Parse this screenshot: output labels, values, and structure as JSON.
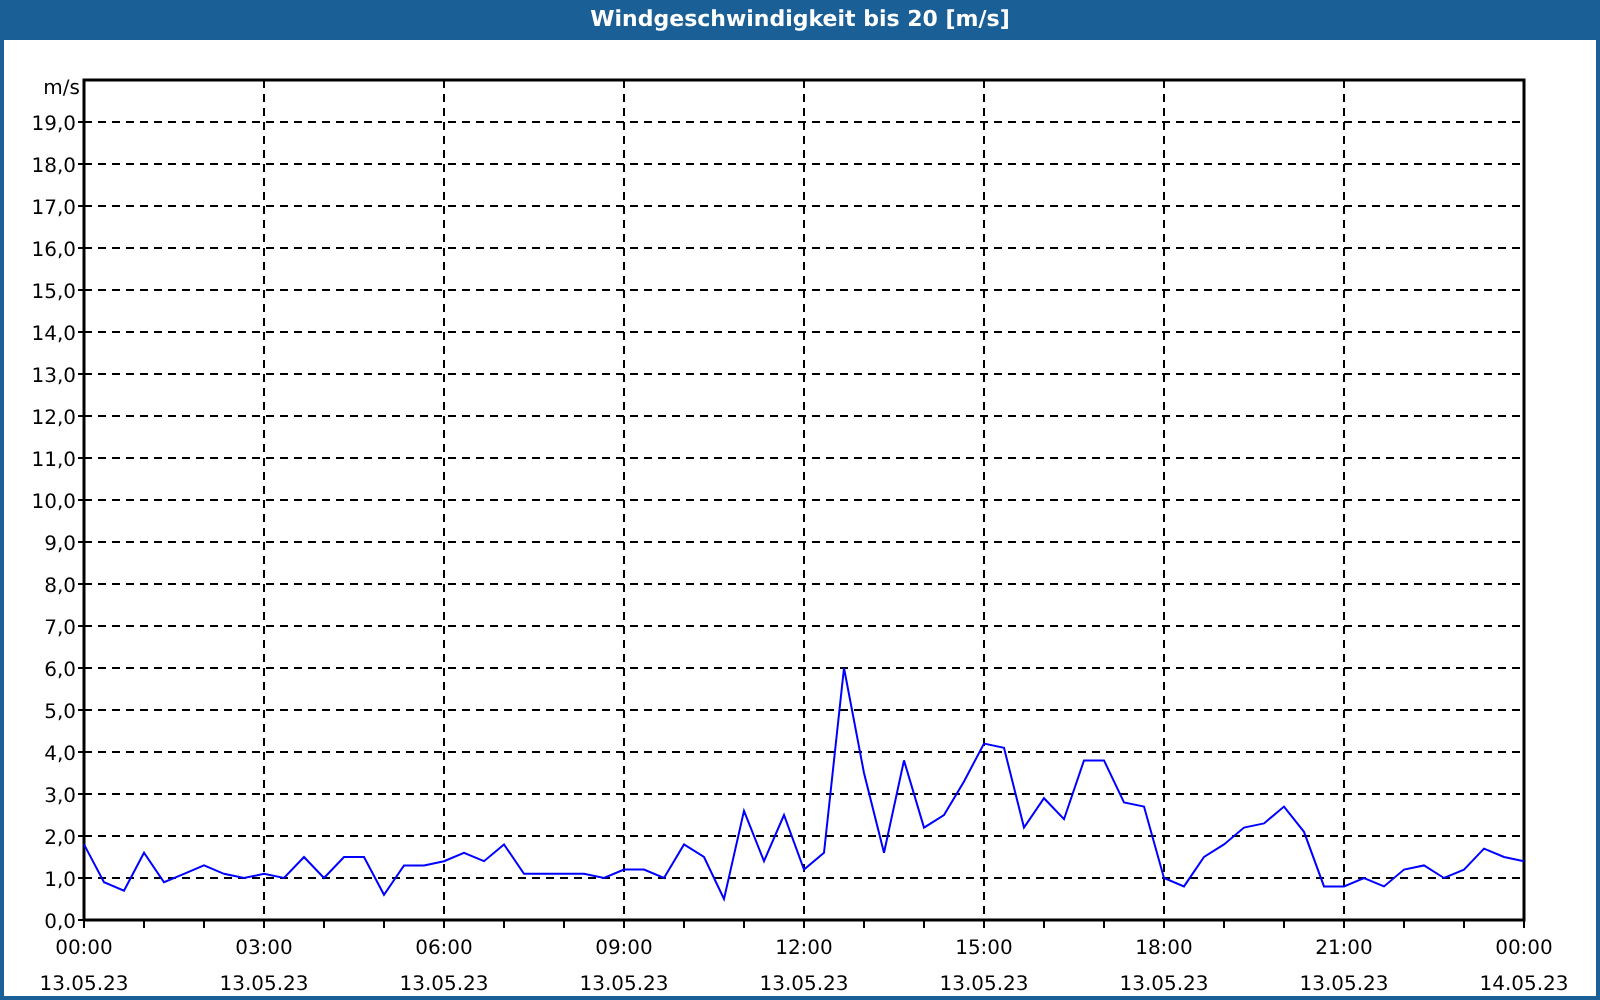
{
  "window": {
    "title": "Windgeschwindigkeit bis 20 [m/s]"
  },
  "chart": {
    "chart_data": {
      "type": "line",
      "grid": true,
      "ylabel": "m/s",
      "ylim": [
        0,
        20
      ],
      "categories": [
        "00:00\n13.05.23",
        null,
        null,
        null,
        null,
        null,
        null,
        null,
        null,
        "03:00\n13.05.23",
        null,
        null,
        null,
        null,
        null,
        null,
        null,
        null,
        "06:00\n13.05.23",
        null,
        null,
        null,
        null,
        null,
        null,
        null,
        null,
        "09:00\n13.05.23",
        null,
        null,
        null,
        null,
        null,
        null,
        null,
        null,
        "12:00\n13.05.23",
        null,
        null,
        null,
        null,
        null,
        null,
        null,
        null,
        "15:00\n13.05.23",
        null,
        null,
        null,
        null,
        null,
        null,
        null,
        null,
        "18:00\n13.05.23",
        null,
        null,
        null,
        null,
        null,
        null,
        null,
        null,
        "21:00\n13.05.23",
        null,
        null,
        null,
        null,
        null,
        null,
        null,
        null,
        "00:00\n14.05.23"
      ],
      "series": [
        {
          "color": "#0000ff",
          "values": [
            1.8,
            0.9,
            0.7,
            1.6,
            0.9,
            1.1,
            1.3,
            1.1,
            1.0,
            1.1,
            1.0,
            1.5,
            1.0,
            1.5,
            1.5,
            0.6,
            1.3,
            1.3,
            1.4,
            1.6,
            1.4,
            1.8,
            1.1,
            1.1,
            1.1,
            1.1,
            1.0,
            1.2,
            1.2,
            1.0,
            1.8,
            1.5,
            0.5,
            2.6,
            1.4,
            2.5,
            1.2,
            1.6,
            6.0,
            3.5,
            1.6,
            3.8,
            2.2,
            2.5,
            3.3,
            4.2,
            4.1,
            2.2,
            2.9,
            2.4,
            3.8,
            3.8,
            2.8,
            2.7,
            1.0,
            0.8,
            1.5,
            1.8,
            2.2,
            2.3,
            2.7,
            2.1,
            0.8,
            0.8,
            1.0,
            0.8,
            1.2,
            1.3,
            1.0,
            1.2,
            1.7,
            1.5,
            1.4
          ]
        }
      ],
      "yticks": [
        {
          "value": 0,
          "label": "0,0"
        },
        {
          "value": 1,
          "label": "1,0"
        },
        {
          "value": 2,
          "label": "2,0"
        },
        {
          "value": 3,
          "label": "3,0"
        },
        {
          "value": 4,
          "label": "4,0"
        },
        {
          "value": 5,
          "label": "5,0"
        },
        {
          "value": 6,
          "label": "6,0"
        },
        {
          "value": 7,
          "label": "7,0"
        },
        {
          "value": 8,
          "label": "8,0"
        },
        {
          "value": 9,
          "label": "9,0"
        },
        {
          "value": 10,
          "label": "10,0"
        },
        {
          "value": 11,
          "label": "11,0"
        },
        {
          "value": 12,
          "label": "12,0"
        },
        {
          "value": 13,
          "label": "13,0"
        },
        {
          "value": 14,
          "label": "14,0"
        },
        {
          "value": 15,
          "label": "15,0"
        },
        {
          "value": 16,
          "label": "16,0"
        },
        {
          "value": 17,
          "label": "17,0"
        },
        {
          "value": 18,
          "label": "18,0"
        },
        {
          "value": 19,
          "label": "19,0"
        }
      ]
    }
  }
}
